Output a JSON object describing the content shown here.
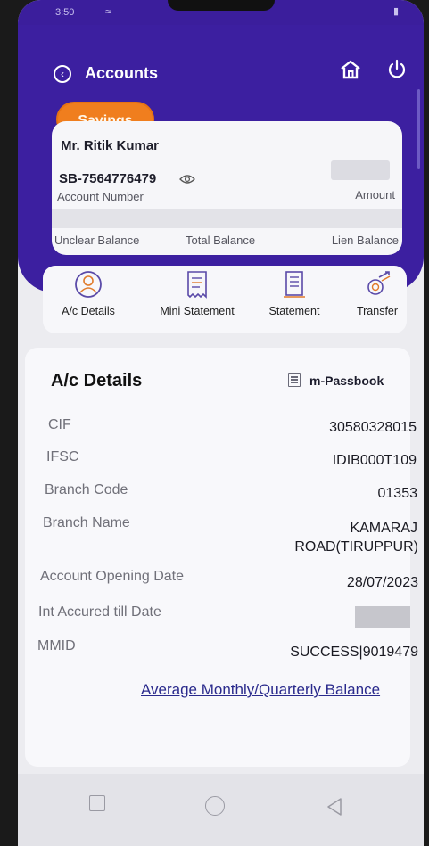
{
  "status": {
    "time": "3:50",
    "battery": ""
  },
  "header": {
    "title": "Accounts",
    "tab_label": "Savings"
  },
  "account": {
    "holder_name": "Mr. Ritik Kumar",
    "number": "SB-7564776479",
    "number_label": "Account Number",
    "amount_label": "Amount",
    "balances": [
      "Unclear Balance",
      "Total Balance",
      "Lien Balance"
    ]
  },
  "actions": [
    {
      "label": "A/c Details",
      "icon": "user-circle-icon"
    },
    {
      "label": "Mini Statement",
      "icon": "receipt-icon"
    },
    {
      "label": "Statement",
      "icon": "document-icon"
    },
    {
      "label": "Transfer",
      "icon": "transfer-icon"
    }
  ],
  "details": {
    "title": "A/c Details",
    "passbook_label": "m-Passbook",
    "rows": [
      {
        "label": "CIF",
        "value": "30580328015"
      },
      {
        "label": "IFSC",
        "value": "IDIB000T109"
      },
      {
        "label": "Branch Code",
        "value": "01353"
      },
      {
        "label": "Branch Name",
        "value": "KAMARAJ",
        "value2": "ROAD(TIRUPPUR)"
      },
      {
        "label": "Account Opening Date",
        "value": "28/07/2023"
      },
      {
        "label": "Int Accured till Date",
        "value": ""
      },
      {
        "label": "MMID",
        "value": "SUCCESS|9019479"
      }
    ],
    "avg_balance_link": "Average Monthly/Quarterly Balance"
  },
  "colors": {
    "primary": "#3c1fa0",
    "accent": "#f07e1e",
    "background": "#ececf0"
  }
}
